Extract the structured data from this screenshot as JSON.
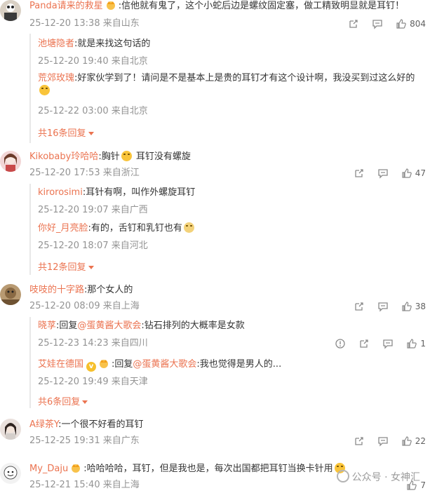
{
  "comments": [
    {
      "name": "Panda请来的救星",
      "text": ":信他就有鬼了，这个小蛇后边是螺纹固定塞，做工精致明显就是耳钉！",
      "time": "25-12-20 13:38",
      "location": "来自山东",
      "likes": "804",
      "replies": [
        {
          "name": "池塘隐者",
          "text": ":就是来找这句话的",
          "time": "25-12-20 19:40",
          "location": "来自北京"
        },
        {
          "name": "荒郊玫瑰",
          "text": ":好家伙学到了！请问是不是基本上是贵的耳钉才有这个设计啊，我没买到过这么好的",
          "time": "25-12-22 03:00",
          "location": "来自北京"
        }
      ],
      "more": "共16条回复"
    },
    {
      "name": "Kikobaby玲哈哈",
      "text": ":胸针",
      "text2": " 耳钉没有螺旋",
      "time": "25-12-20 17:53",
      "location": "来自浙江",
      "likes": "47",
      "replies": [
        {
          "name": "kirorosimi",
          "text": ":耳针有啊，叫作外螺旋耳钉",
          "time": "25-12-20 19:07",
          "location": "来自广西"
        },
        {
          "name": "你好_月亮脸",
          "text": ":有的，舌钉和乳钉也有",
          "time": "25-12-20 18:07",
          "location": "来自河北"
        }
      ],
      "more": "共12条回复"
    },
    {
      "name": "吱吱的十字路",
      "text": ":那个女人的",
      "time": "25-12-20 08:09",
      "location": "来自上海",
      "likes": "38",
      "replies": [
        {
          "name": "晓莩",
          "prefix": ":回复",
          "mention": "@蛋黄酱大歌会",
          "text": ":钻石排列的大概率是女款",
          "time": "25-12-23 14:23",
          "location": "来自四川",
          "likes": "1"
        },
        {
          "name": "艾娃在德国",
          "prefix": ":回复",
          "mention": "@蛋黄酱大歌会",
          "text": ":我也觉得是男人的...",
          "time": "25-12-20 19:49",
          "location": "来自天津"
        }
      ],
      "more": "共6条回复"
    },
    {
      "name": "A绿茶Y",
      "text": ":一个很不好看的耳钉",
      "time": "25-12-25 19:31",
      "location": "来自广东",
      "likes": "22"
    },
    {
      "name": "My_Daju",
      "text": ":哈哈哈哈，耳钉，但是我也是，每次出国都把耳钉当换卡针用",
      "time": "25-12-21 15:40",
      "location": "来自上海",
      "likes": "7"
    }
  ],
  "watermark": "公众号 · 女神汇",
  "colors": {
    "name": "#eb7350",
    "meta": "#939393",
    "text": "#333333"
  }
}
